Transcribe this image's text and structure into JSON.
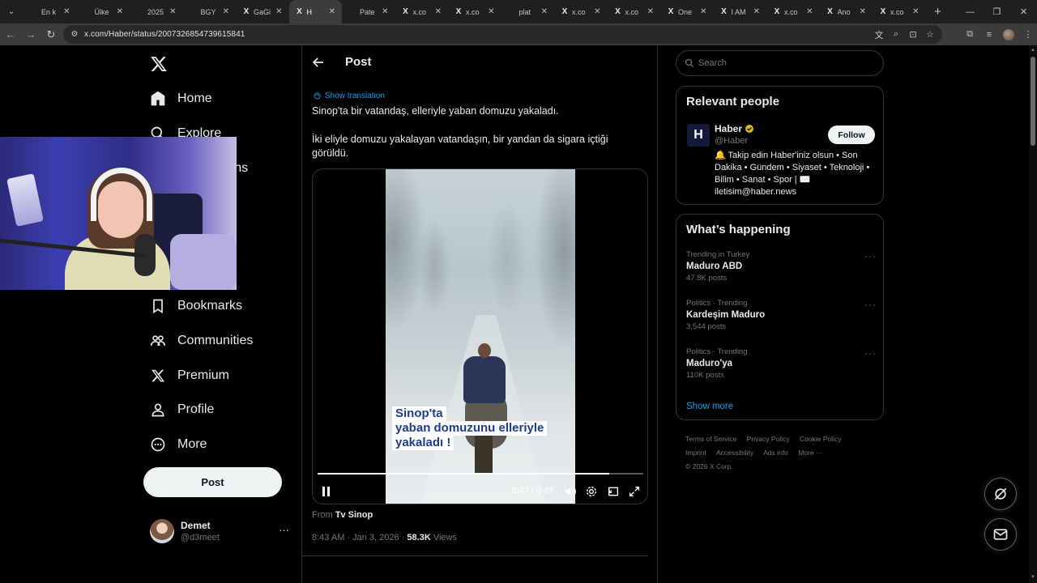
{
  "browser": {
    "tabs": [
      {
        "favicon": "",
        "title": "En k"
      },
      {
        "favicon": "",
        "title": "Ülke"
      },
      {
        "favicon": "",
        "title": "2025"
      },
      {
        "favicon": "",
        "title": "BGY"
      },
      {
        "favicon": "X",
        "title": "GaGi"
      },
      {
        "favicon": "X",
        "title": "H"
      },
      {
        "favicon": "",
        "title": "Pate"
      },
      {
        "favicon": "X",
        "title": "x.co"
      },
      {
        "favicon": "X",
        "title": "x.co"
      },
      {
        "favicon": "",
        "title": "plat"
      },
      {
        "favicon": "X",
        "title": "x.co"
      },
      {
        "favicon": "X",
        "title": "x.co"
      },
      {
        "favicon": "X",
        "title": "One"
      },
      {
        "favicon": "X",
        "title": "I AM"
      },
      {
        "favicon": "X",
        "title": "x.co"
      },
      {
        "favicon": "X",
        "title": "Ano"
      },
      {
        "favicon": "X",
        "title": "x.co"
      }
    ],
    "active_tab_index": 5,
    "url": "x.com/Haber/status/2007326854739615841"
  },
  "sidebar": {
    "items": [
      {
        "icon": "home-icon",
        "label": "Home"
      },
      {
        "icon": "search-icon",
        "label": "Explore"
      },
      {
        "icon": "bell-icon",
        "label": "Notifications"
      },
      {
        "icon": "bookmark-icon",
        "label": "Bookmarks"
      },
      {
        "icon": "communities-icon",
        "label": "Communities"
      },
      {
        "icon": "x-logo-icon",
        "label": "Premium"
      },
      {
        "icon": "person-icon",
        "label": "Profile"
      },
      {
        "icon": "more-circle-icon",
        "label": "More"
      }
    ],
    "post_button": "Post",
    "account": {
      "name": "Demet",
      "handle": "@d3meet"
    }
  },
  "header": {
    "title": "Post"
  },
  "tweet": {
    "show_translation": "Show translation",
    "text_line1": "Sinop'ta bir vatandaş, elleriyle yaban domuzu yakaladı.",
    "text_line2a": "İki eliyle domuzu yakalayan vatandaşın, bir yandan da sigara içtiği",
    "text_line2b": "görüldü.",
    "video": {
      "caption_line1": "Sinop'ta",
      "caption_line2": "yaban domuzunu elleriyle",
      "caption_line3": "yakaladı !",
      "time": "0:43 / 0:48",
      "progress": 0.896
    },
    "from_label": "From",
    "from_source": "Tv Sinop",
    "timestamp": "8:43 AM · Jan 3, 2026 · ",
    "views_count": "58.3K",
    "views_label": " Views"
  },
  "search": {
    "placeholder": "Search"
  },
  "relevant_people": {
    "title": "Relevant people",
    "person": {
      "logo_letter": "H",
      "name": "Haber",
      "handle": "@Haber",
      "bio": "🔔 Takip edin Haber'iniz olsun • Son Dakika • Gündem • Siyaset • Teknoloji • Bilim • Sanat • Spor | ✉️ iletisim@haber.news",
      "follow_label": "Follow"
    }
  },
  "whats_happening": {
    "title": "What’s happening",
    "trends": [
      {
        "context": "Trending in Turkey",
        "name": "Maduro ABD",
        "count": "47.8K posts"
      },
      {
        "context": "Politics · Trending",
        "name": "Kardeşim Maduro",
        "count": "3,544 posts"
      },
      {
        "context": "Politics · Trending",
        "name": "Maduro'ya",
        "count": "110K posts"
      }
    ],
    "show_more": "Show more"
  },
  "footer": {
    "links_row1": [
      "Terms of Service",
      "Privacy Policy",
      "Cookie Policy"
    ],
    "links_row2": [
      "Imprint",
      "Accessibility",
      "Ads info",
      "More ···"
    ],
    "copyright": "© 2026 X Corp."
  },
  "colors": {
    "accent": "#1d9bf0",
    "background": "#000000",
    "border": "#2f3336",
    "muted": "#71767b",
    "text": "#e7e9ea"
  }
}
